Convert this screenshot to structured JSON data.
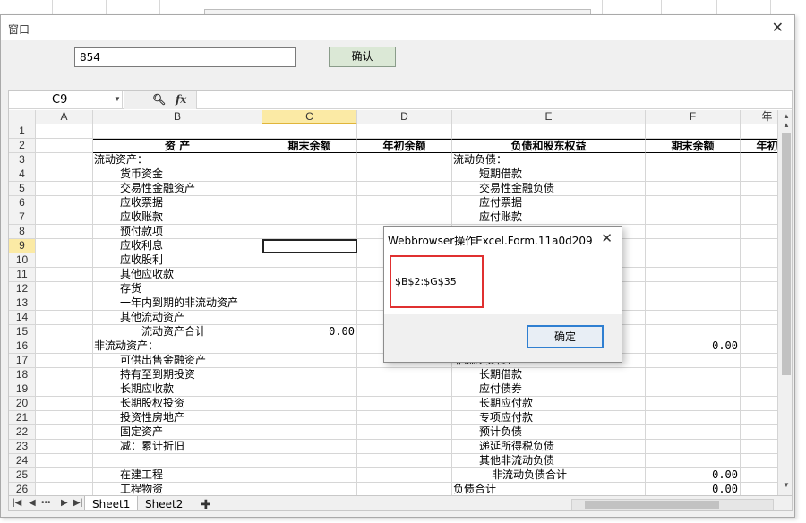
{
  "main_window": {
    "title": "窗口",
    "close_glyph": "✕"
  },
  "top_input": {
    "value": "854"
  },
  "confirm_button": {
    "label": "确认"
  },
  "formula_bar": {
    "name_box": "C9",
    "zoom_icon": "magnifier-icon",
    "fx_label": "fx"
  },
  "columns": [
    "A",
    "B",
    "C",
    "D",
    "E",
    "F",
    "年"
  ],
  "selected_column": "C",
  "rows": [
    {
      "n": "1",
      "B": "",
      "C": "",
      "D": "",
      "E": "",
      "F": "",
      "G": ""
    },
    {
      "n": "2",
      "B": "资          产",
      "C": "期末余额",
      "D": "年初余额",
      "E": "负债和股东权益",
      "F": "期末余额",
      "G": "年初"
    },
    {
      "n": "3",
      "B": "流动资产：",
      "C": "",
      "D": "",
      "E": "流动负债：",
      "F": "",
      "G": ""
    },
    {
      "n": "4",
      "B": "货币资金",
      "C": "",
      "D": "",
      "E": "短期借款",
      "F": "",
      "G": ""
    },
    {
      "n": "5",
      "B": "交易性金融资产",
      "C": "",
      "D": "",
      "E": "交易性金融负债",
      "F": "",
      "G": ""
    },
    {
      "n": "6",
      "B": "应收票据",
      "C": "",
      "D": "",
      "E": "应付票据",
      "F": "",
      "G": ""
    },
    {
      "n": "7",
      "B": "应收账款",
      "C": "",
      "D": "",
      "E": "应付账款",
      "F": "",
      "G": ""
    },
    {
      "n": "8",
      "B": "预付款项",
      "C": "",
      "D": "",
      "E": "",
      "F": "",
      "G": ""
    },
    {
      "n": "9",
      "B": "应收利息",
      "C": "",
      "D": "",
      "E": "",
      "F": "",
      "G": ""
    },
    {
      "n": "10",
      "B": "应收股利",
      "C": "",
      "D": "",
      "E": "",
      "F": "",
      "G": ""
    },
    {
      "n": "11",
      "B": "其他应收款",
      "C": "",
      "D": "",
      "E": "",
      "F": "",
      "G": ""
    },
    {
      "n": "12",
      "B": "存货",
      "C": "",
      "D": "",
      "E": "",
      "F": "",
      "G": ""
    },
    {
      "n": "13",
      "B": "一年内到期的非流动资产",
      "C": "",
      "D": "",
      "E": "",
      "F": "",
      "G": ""
    },
    {
      "n": "14",
      "B": "其他流动资产",
      "C": "",
      "D": "",
      "E": "",
      "F": "",
      "G": ""
    },
    {
      "n": "15",
      "B": "流动资产合计",
      "C": "0.00",
      "D": "",
      "E": "",
      "F": "",
      "G": ""
    },
    {
      "n": "16",
      "B": "非流动资产：",
      "C": "",
      "D": "",
      "E": "",
      "F": "0.00",
      "G": ""
    },
    {
      "n": "17",
      "B": "可供出售金融资产",
      "C": "",
      "D": "",
      "E": "非流动负债：",
      "F": "",
      "G": ""
    },
    {
      "n": "18",
      "B": "持有至到期投资",
      "C": "",
      "D": "",
      "E": "长期借款",
      "F": "",
      "G": ""
    },
    {
      "n": "19",
      "B": "长期应收款",
      "C": "",
      "D": "",
      "E": "应付债券",
      "F": "",
      "G": ""
    },
    {
      "n": "20",
      "B": "长期股权投资",
      "C": "",
      "D": "",
      "E": "长期应付款",
      "F": "",
      "G": ""
    },
    {
      "n": "21",
      "B": "投资性房地产",
      "C": "",
      "D": "",
      "E": "专项应付款",
      "F": "",
      "G": ""
    },
    {
      "n": "22",
      "B": "固定资产",
      "C": "",
      "D": "",
      "E": "预计负债",
      "F": "",
      "G": ""
    },
    {
      "n": "23",
      "B": "减：累计折旧",
      "C": "",
      "D": "",
      "E": "递延所得税负债",
      "F": "",
      "G": ""
    },
    {
      "n": "24",
      "B": "",
      "C": "",
      "D": "",
      "E": "其他非流动负债",
      "F": "",
      "G": ""
    },
    {
      "n": "25",
      "B": "在建工程",
      "C": "",
      "D": "",
      "E": "非流动负债合计",
      "F": "0.00",
      "G": ""
    },
    {
      "n": "26",
      "B": "工程物资",
      "C": "",
      "D": "",
      "E": "负债合计",
      "F": "0.00",
      "G": ""
    }
  ],
  "sheet_tabs": [
    "Sheet1",
    "Sheet2"
  ],
  "active_sheet": "Sheet1",
  "dialog": {
    "title": "Webbrowser操作Excel.Form.11a0d209",
    "message": "$B$2:$G$35",
    "ok_label": "确定",
    "close_glyph": "✕"
  }
}
